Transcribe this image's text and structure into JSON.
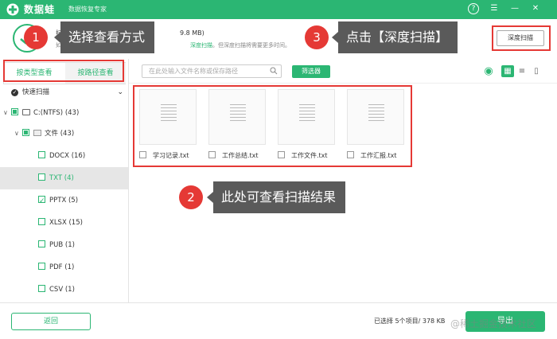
{
  "app": {
    "name": "数据蛙",
    "subtitle": "数据恢复专家",
    "brand_color": "#2bb673",
    "help_icon": "?",
    "menu_icon": "☰",
    "minimize_icon": "—",
    "close_icon": "✕"
  },
  "header": {
    "status_line1_left": "扫",
    "status_line1_right": "9.8 MB)",
    "status_line2_left": "如",
    "status_line2_link": "深度扫描",
    "status_line2_right": "。但深度扫描将需要更多时间。",
    "deep_scan_label": "深度扫描"
  },
  "callouts": [
    {
      "num": "1",
      "text": "选择查看方式"
    },
    {
      "num": "2",
      "text": "此处可查看扫描结果"
    },
    {
      "num": "3",
      "text": "点击【深度扫描】"
    }
  ],
  "sidebar": {
    "tab_type": "按类型查看",
    "tab_path": "按路径查看",
    "quick_scan": "快速扫描",
    "drive": "C:(NTFS) (43)",
    "folder": "文件 (43)",
    "types": [
      {
        "label": "DOCX (16)",
        "checked": false
      },
      {
        "label": "TXT (4)",
        "checked": false
      },
      {
        "label": "PPTX (5)",
        "checked": true
      },
      {
        "label": "XLSX (15)",
        "checked": false
      },
      {
        "label": "PUB (1)",
        "checked": false
      },
      {
        "label": "PDF (1)",
        "checked": false
      },
      {
        "label": "CSV (1)",
        "checked": false
      }
    ]
  },
  "toolbar": {
    "search_placeholder": "在此处输入文件名称或保存路径",
    "filter_label": "筛选器",
    "eye_icon": "◉",
    "grid_icon": "▦",
    "list_icon": "≡",
    "detail_icon": "▯"
  },
  "files": [
    {
      "name": "学习记录.txt"
    },
    {
      "name": "工作总结.txt"
    },
    {
      "name": "工作文件.txt"
    },
    {
      "name": "工作汇报.txt"
    }
  ],
  "footer": {
    "back_label": "返回",
    "selection_info": "已选择 5个项目/ 378 KB",
    "export_label": "导出",
    "watermark": "@稀土掘金技术社区"
  }
}
